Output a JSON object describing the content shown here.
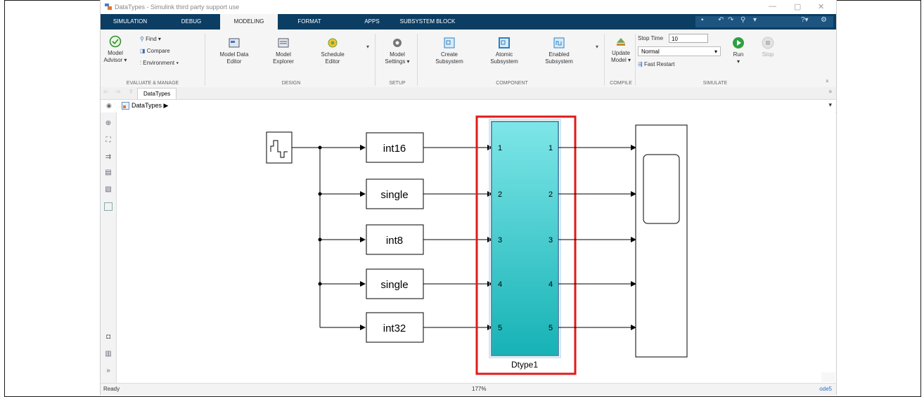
{
  "window": {
    "title": "DataTypes - Simulink third party support use",
    "controls": [
      "—",
      "▢",
      "✕"
    ]
  },
  "tabs": [
    {
      "label": "SIMULATION",
      "active": false
    },
    {
      "label": "DEBUG",
      "active": false
    },
    {
      "label": "MODELING",
      "active": true
    },
    {
      "label": "FORMAT",
      "active": false
    },
    {
      "label": "APPS",
      "active": false
    },
    {
      "label": "SUBSYSTEM BLOCK",
      "active": false
    }
  ],
  "ribbon": {
    "evaluate_manage": {
      "label": "EVALUATE & MANAGE",
      "model_advisor": {
        "line1": "Model",
        "line2": "Advisor ▾"
      },
      "find": "Find ▾",
      "compare": "Compare",
      "environment": "Environment ▾"
    },
    "design": {
      "label": "DESIGN",
      "model_data_editor": {
        "line1": "Model Data",
        "line2": "Editor"
      },
      "model_explorer": {
        "line1": "Model",
        "line2": "Explorer"
      },
      "schedule_editor": {
        "line1": "Schedule",
        "line2": "Editor"
      }
    },
    "setup": {
      "label": "SETUP",
      "model_settings": {
        "line1": "Model",
        "line2": "Settings ▾"
      }
    },
    "component": {
      "label": "COMPONENT",
      "create_subsystem": {
        "line1": "Create",
        "line2": "Subsystem"
      },
      "atomic_subsystem": {
        "line1": "Atomic",
        "line2": "Subsystem"
      },
      "enabled_subsystem": {
        "line1": "Enabled",
        "line2": "Subsystem"
      }
    },
    "compile": {
      "label": "COMPILE",
      "update_model": {
        "line1": "Update",
        "line2": "Model ▾"
      }
    },
    "simulate": {
      "label": "SIMULATE",
      "stop_time_label": "Stop Time",
      "stop_time_value": "10",
      "mode": "Normal",
      "fast_restart": "Fast Restart",
      "run": "Run",
      "stop": "Stop"
    }
  },
  "breadcrumb": {
    "tab": "DataTypes"
  },
  "address": {
    "path": "DataTypes ▶"
  },
  "diagram": {
    "converters": [
      "int16",
      "single",
      "int8",
      "single",
      "int32"
    ],
    "subsystem": {
      "name": "Dtype1",
      "in_ports": [
        "1",
        "2",
        "3",
        "4",
        "5"
      ],
      "out_ports": [
        "1",
        "2",
        "3",
        "4",
        "5"
      ]
    }
  },
  "status": {
    "left": "Ready",
    "zoom": "177%",
    "solver": "ode5"
  },
  "colors": {
    "tab_bar": "#0c3d63",
    "subsystem_top": "#7ee6e8",
    "subsystem_bottom": "#16b2b5",
    "highlight": "#e01a1a"
  }
}
